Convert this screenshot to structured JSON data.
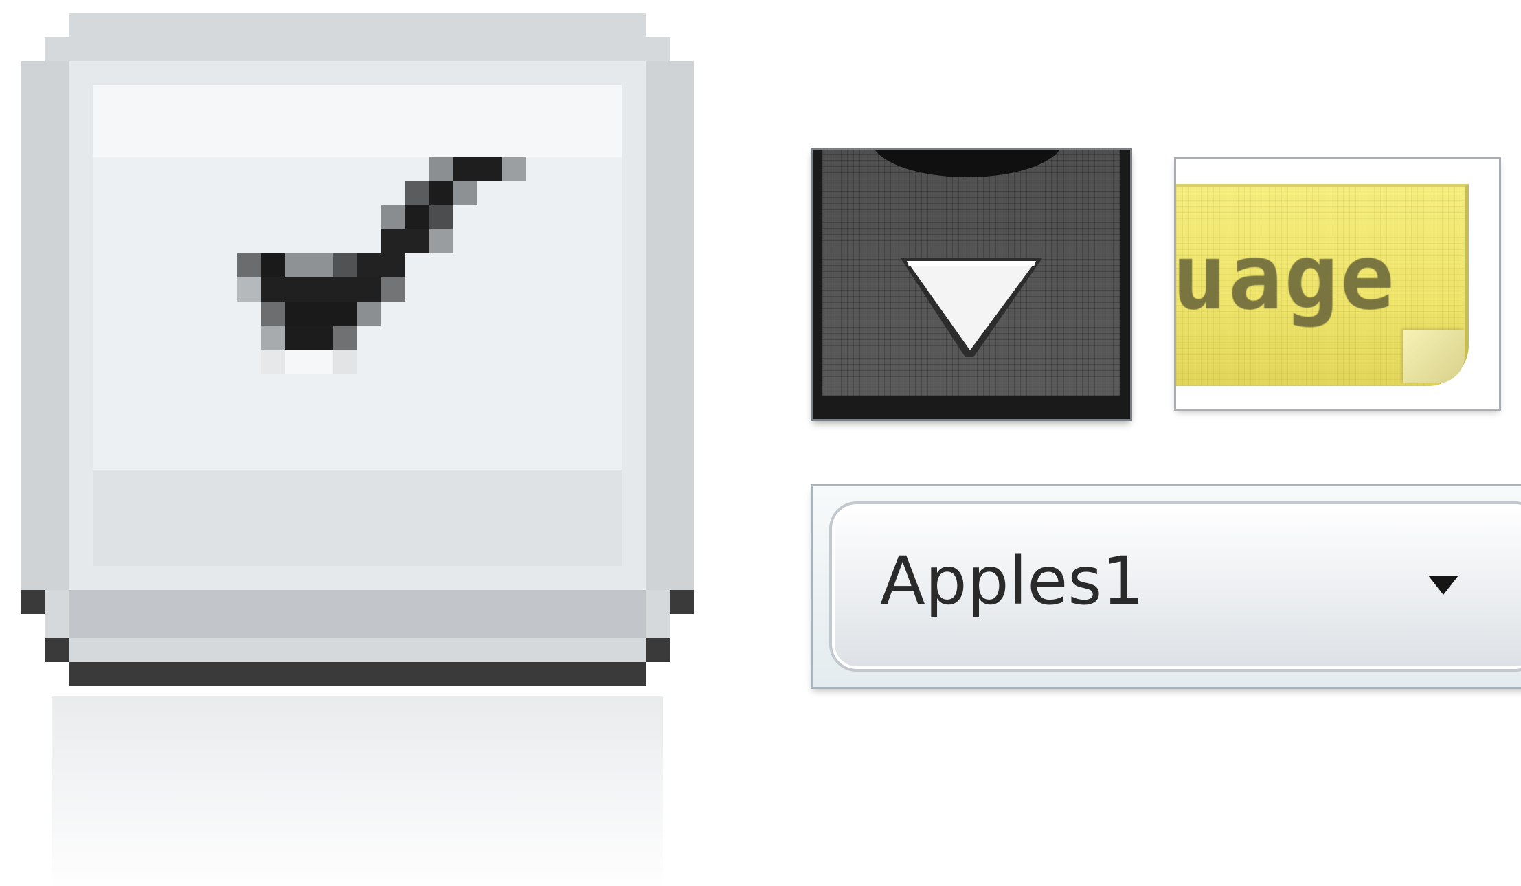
{
  "icons": {
    "checkbox": "checkmark-icon",
    "dropdown_tile": "dropdown-arrow-icon",
    "label_tile": "label-tag-icon",
    "combo_arrow": "chevron-down-icon"
  },
  "label_tile": {
    "text": "uage"
  },
  "combobox": {
    "selected_value": "Apples1"
  },
  "colors": {
    "checkbox_face": "#e3e6e9",
    "arrow_tile_bg": "#575757",
    "label_yellow": "#ede36a",
    "combo_text": "#2a2a2a"
  }
}
